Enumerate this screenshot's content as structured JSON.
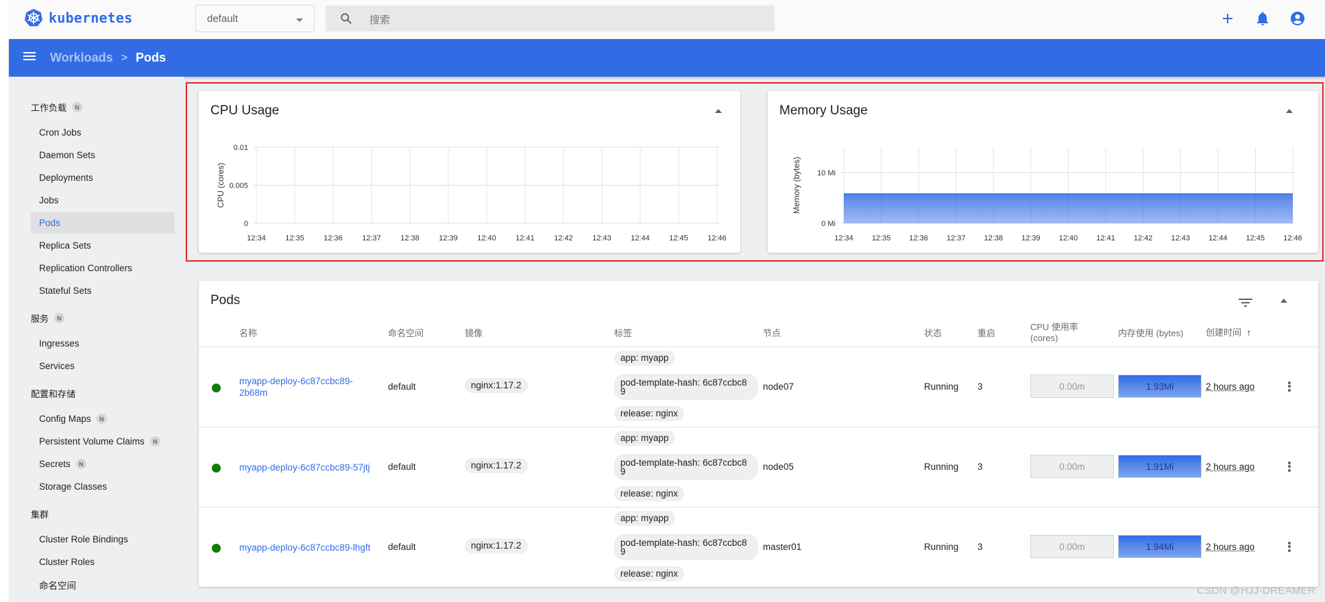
{
  "app": {
    "name": "kubernetes"
  },
  "toolbar": {
    "namespace": "default",
    "search_placeholder": "搜索",
    "actions": [
      "add-icon",
      "notifications-icon",
      "account-icon"
    ]
  },
  "breadcrumb": {
    "parent": "Workloads",
    "separator": ">",
    "current": "Pods"
  },
  "sidebar": {
    "groups": [
      {
        "label": "工作负载",
        "badge": "N",
        "items": [
          {
            "label": "Cron Jobs"
          },
          {
            "label": "Daemon Sets"
          },
          {
            "label": "Deployments"
          },
          {
            "label": "Jobs"
          },
          {
            "label": "Pods",
            "active": true
          },
          {
            "label": "Replica Sets"
          },
          {
            "label": "Replication Controllers"
          },
          {
            "label": "Stateful Sets"
          }
        ]
      },
      {
        "label": "服务",
        "badge": "N",
        "items": [
          {
            "label": "Ingresses"
          },
          {
            "label": "Services"
          }
        ]
      },
      {
        "label": "配置和存储",
        "items": [
          {
            "label": "Config Maps",
            "badge": "N"
          },
          {
            "label": "Persistent Volume Claims",
            "badge": "N"
          },
          {
            "label": "Secrets",
            "badge": "N"
          },
          {
            "label": "Storage Classes"
          }
        ]
      },
      {
        "label": "集群",
        "items": [
          {
            "label": "Cluster Role Bindings"
          },
          {
            "label": "Cluster Roles"
          },
          {
            "label": "命名空间"
          }
        ]
      }
    ]
  },
  "chart_data": [
    {
      "type": "line",
      "title": "CPU Usage",
      "xlabel": "",
      "ylabel": "CPU (cores)",
      "x": [
        "12:34",
        "12:35",
        "12:36",
        "12:37",
        "12:38",
        "12:39",
        "12:40",
        "12:41",
        "12:42",
        "12:43",
        "12:44",
        "12:45",
        "12:46"
      ],
      "yticks": [
        "0",
        "0.005",
        "0.01"
      ],
      "ylim": [
        0,
        0.01
      ],
      "series": [
        {
          "name": "CPU",
          "values": [
            0,
            0,
            0,
            0,
            0,
            0,
            0,
            0,
            0,
            0,
            0,
            0,
            0
          ]
        }
      ],
      "grid": true
    },
    {
      "type": "area",
      "title": "Memory Usage",
      "xlabel": "",
      "ylabel": "Memory (bytes)",
      "x": [
        "12:34",
        "12:35",
        "12:36",
        "12:37",
        "12:38",
        "12:39",
        "12:40",
        "12:41",
        "12:42",
        "12:43",
        "12:44",
        "12:45",
        "12:46"
      ],
      "yticks": [
        "0 Mi",
        "10 Mi"
      ],
      "ylim": [
        0,
        15
      ],
      "series": [
        {
          "name": "Memory (Mi)",
          "values": [
            5.8,
            5.8,
            5.8,
            5.8,
            5.8,
            5.8,
            5.8,
            5.8,
            5.8,
            5.8,
            5.8,
            5.8,
            5.8
          ]
        }
      ],
      "grid": true,
      "color": "#326ce5"
    }
  ],
  "pods": {
    "title": "Pods",
    "columns": [
      "名称",
      "命名空间",
      "镜像",
      "标签",
      "节点",
      "状态",
      "重启",
      "CPU 使用率 (cores)",
      "内存使用 (bytes)",
      "创建时间"
    ],
    "sort_indicator": "↑",
    "rows": [
      {
        "name": "myapp-deploy-6c87ccbc89-2b68m",
        "namespace": "default",
        "image": "nginx:1.17.2",
        "labels": [
          "app: myapp",
          "pod-template-hash: 6c87ccbc89",
          "release: nginx"
        ],
        "node": "node07",
        "status": "Running",
        "restarts": "3",
        "cpu": "0.00m",
        "memory": "1.93Mi",
        "created": "2 hours ago"
      },
      {
        "name": "myapp-deploy-6c87ccbc89-57jtj",
        "namespace": "default",
        "image": "nginx:1.17.2",
        "labels": [
          "app: myapp",
          "pod-template-hash: 6c87ccbc89",
          "release: nginx"
        ],
        "node": "node05",
        "status": "Running",
        "restarts": "3",
        "cpu": "0.00m",
        "memory": "1.91Mi",
        "created": "2 hours ago"
      },
      {
        "name": "myapp-deploy-6c87ccbc89-lhgft",
        "namespace": "default",
        "image": "nginx:1.17.2",
        "labels": [
          "app: myapp",
          "pod-template-hash: 6c87ccbc89",
          "release: nginx"
        ],
        "node": "master01",
        "status": "Running",
        "restarts": "3",
        "cpu": "0.00m",
        "memory": "1.94Mi",
        "created": "2 hours ago"
      }
    ]
  },
  "colors": {
    "brand": "#326ce5",
    "running": "#0d7d0d",
    "highlight_box": "#e3232b"
  },
  "watermark": "CSDN @HJJ-DREAMER"
}
